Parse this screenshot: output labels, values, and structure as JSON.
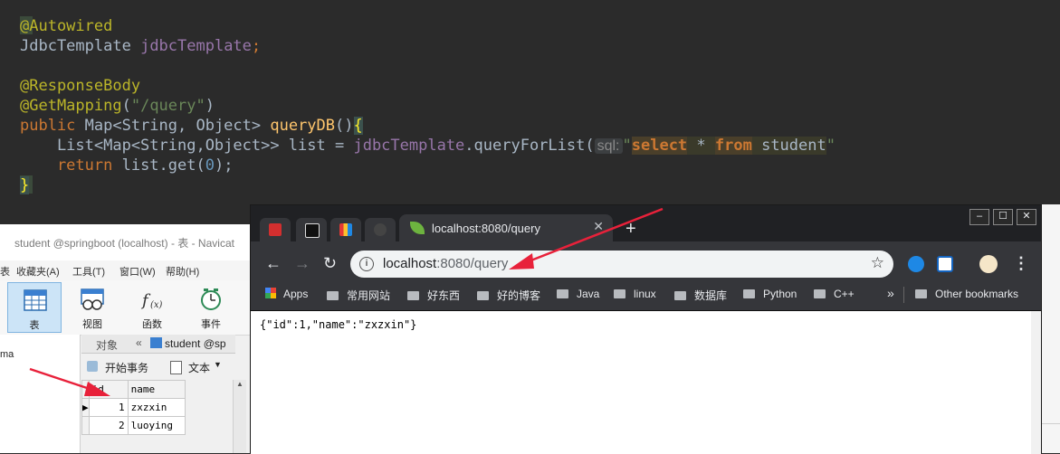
{
  "editor": {
    "line1": "@Autowired",
    "line2_type": "JdbcTemplate",
    "line2_field": "jdbcTemplate",
    "line2_semi": ";",
    "line3": "@ResponseBody",
    "line4_ann": "@GetMapping",
    "line4_open": "(",
    "line4_str": "\"/query\"",
    "line4_close": ")",
    "line5_public": "public",
    "line5_type": " Map<String, Object> ",
    "line5_method": "queryDB",
    "line5_paren": "()",
    "line5_brace": "{",
    "line6_type": "    List<Map<String,Object>> list = ",
    "line6_field": "jdbcTemplate",
    "line6_call": ".queryForList(",
    "line6_hint": "sql:",
    "line6_quote": "\"",
    "line6_select": "select",
    "line6_star": " * ",
    "line6_from": "from",
    "line6_table": " student",
    "line6_endquote": "\"",
    "line7_return": "    return",
    "line7_rest": " list.get(",
    "line7_num": "0",
    "line7_end": ");",
    "line8_brace": "}"
  },
  "navicat": {
    "title": "student @springboot (localhost) - 表 - Navicat",
    "menu": [
      "表",
      "收藏夹(A)",
      "工具(T)",
      "窗口(W)",
      "帮助(H)"
    ],
    "tools": [
      {
        "label": "表",
        "icon": "table-icon"
      },
      {
        "label": "视图",
        "icon": "view-icon"
      },
      {
        "label": "函数",
        "icon": "function-icon"
      },
      {
        "label": "事件",
        "icon": "event-clock-icon"
      }
    ],
    "left_tree_text": "ma",
    "tabs": {
      "objects": "对象",
      "current": "student @sp"
    },
    "subtoolbar": {
      "begin_tx": "开始事务",
      "text": "文本"
    },
    "grid": {
      "columns": [
        "id",
        "name"
      ],
      "rows": [
        {
          "id": "1",
          "name": "zxzxin"
        },
        {
          "id": "2",
          "name": "luoying"
        }
      ]
    }
  },
  "browser": {
    "tab_title": "localhost:8080/query",
    "new_tab": "+",
    "window_controls": {
      "minimize": "–",
      "maximize": "☐",
      "close": "✕"
    },
    "address": {
      "host": "localhost",
      "path": ":8080/query"
    },
    "bookmarks": [
      "Apps",
      "常用网站",
      "好东西",
      "好的博客",
      "Java",
      "linux",
      "数据库",
      "Python",
      "C++"
    ],
    "overflow": "»",
    "other_bookmarks": "Other bookmarks",
    "page_body": "{\"id\":1,\"name\":\"zxzxin\"}"
  },
  "colors": {
    "editor_bg": "#2b2b2b",
    "annotation": "#bbb529",
    "keyword": "#cc7832",
    "field": "#9876aa",
    "string": "#6a8759",
    "method": "#ffc66d",
    "number": "#6897bb",
    "chrome_dark": "#35363a",
    "arrow": "#e8213a"
  }
}
